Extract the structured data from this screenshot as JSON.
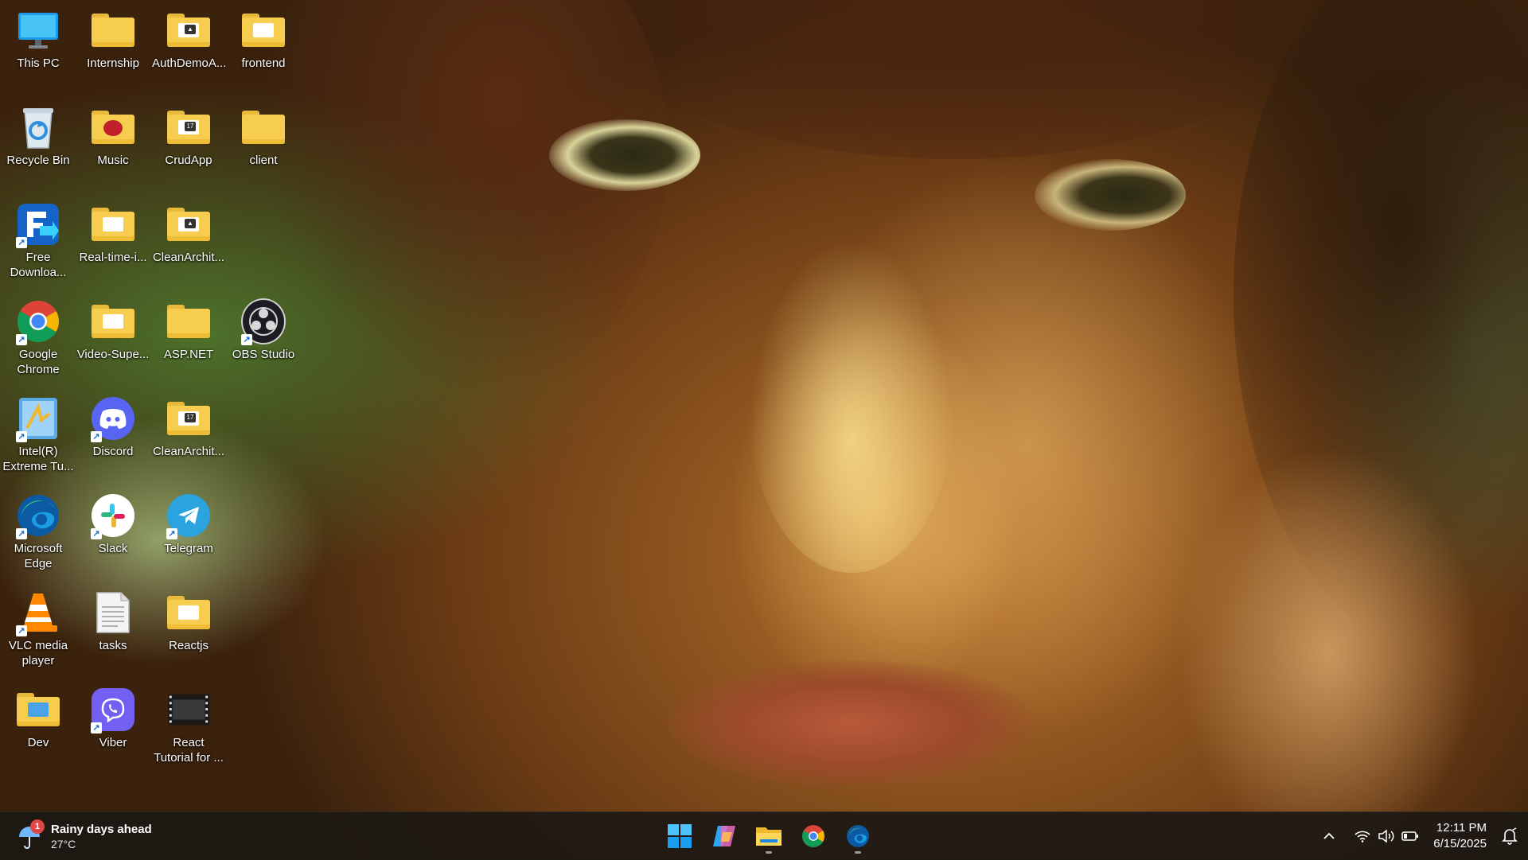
{
  "desktop": {
    "icons": [
      {
        "label": "This PC",
        "icon": "monitor-icon"
      },
      {
        "label": "Internship",
        "icon": "folder-icon"
      },
      {
        "label": "AuthDemoA...",
        "icon": "folder-icon"
      },
      {
        "label": "frontend",
        "icon": "folder-icon"
      },
      {
        "label": "Recycle Bin",
        "icon": "recycle-bin-icon"
      },
      {
        "label": "Music",
        "icon": "folder-icon"
      },
      {
        "label": "CrudApp",
        "icon": "folder-icon"
      },
      {
        "label": "client",
        "icon": "folder-icon"
      },
      {
        "label": "Free Downloa...",
        "icon": "free-download-manager-icon"
      },
      {
        "label": "Real-time-i...",
        "icon": "folder-icon"
      },
      {
        "label": "CleanArchit...",
        "icon": "folder-icon"
      },
      {
        "label": "Google Chrome",
        "icon": "chrome-icon"
      },
      {
        "label": "Video-Supe...",
        "icon": "folder-icon"
      },
      {
        "label": "ASP.NET",
        "icon": "folder-icon"
      },
      {
        "label": "OBS Studio",
        "icon": "obs-icon"
      },
      {
        "label": "Intel(R) Extreme Tu...",
        "icon": "intel-xtu-icon"
      },
      {
        "label": "Discord",
        "icon": "discord-icon"
      },
      {
        "label": "CleanArchit...",
        "icon": "folder-icon"
      },
      {
        "label": "Microsoft Edge",
        "icon": "edge-icon"
      },
      {
        "label": "Slack",
        "icon": "slack-icon"
      },
      {
        "label": "Telegram",
        "icon": "telegram-icon"
      },
      {
        "label": "VLC media player",
        "icon": "vlc-icon"
      },
      {
        "label": "tasks",
        "icon": "text-file-icon"
      },
      {
        "label": "Reactjs",
        "icon": "folder-icon"
      },
      {
        "label": "Dev",
        "icon": "folder-icon"
      },
      {
        "label": "Viber",
        "icon": "viber-icon"
      },
      {
        "label": "React Tutorial for ...",
        "icon": "video-file-icon"
      }
    ]
  },
  "taskbar": {
    "weather": {
      "title": "Rainy days ahead",
      "temp": "27°C",
      "badge": "1",
      "icon": "umbrella-icon"
    },
    "pinned": [
      {
        "name": "Start",
        "icon": "windows-start-icon"
      },
      {
        "name": "Copilot",
        "icon": "copilot-icon"
      },
      {
        "name": "File Explorer",
        "icon": "file-explorer-icon"
      },
      {
        "name": "Google Chrome",
        "icon": "chrome-icon"
      },
      {
        "name": "Microsoft Edge",
        "icon": "edge-icon"
      }
    ],
    "tray": {
      "icons": [
        "chevron-up-icon",
        "wifi-icon",
        "volume-icon",
        "battery-icon"
      ],
      "time": "12:11 PM",
      "date": "6/15/2025",
      "notification_icon": "notification-bell-icon"
    }
  },
  "colors": {
    "folder": "#f6cd4f",
    "taskbar": "#1c1814",
    "accent": "#0078d4"
  }
}
